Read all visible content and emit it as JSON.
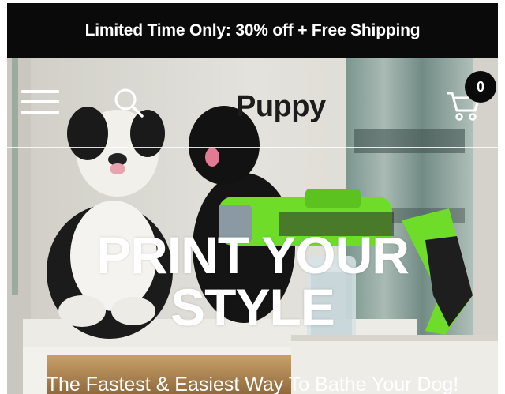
{
  "announcement": {
    "text": "Limited Time Only: 30% off + Free Shipping"
  },
  "header": {
    "menu_icon": "hamburger-menu-icon",
    "search_icon": "search-icon",
    "logo_text": "Puppy",
    "cart_icon": "shopping-cart-icon",
    "cart_count": "0"
  },
  "hero": {
    "headline_line1": "PRINT YOUR",
    "headline_line2": "STYLE",
    "subheadline": "The Fastest & Easiest Way To Bathe Your Dog!"
  },
  "colors": {
    "announcement_bg": "#0a0a0a",
    "text_light": "#ffffff",
    "sprayer_green": "#6fdc2a",
    "logo_dark": "#1c1c1c"
  }
}
